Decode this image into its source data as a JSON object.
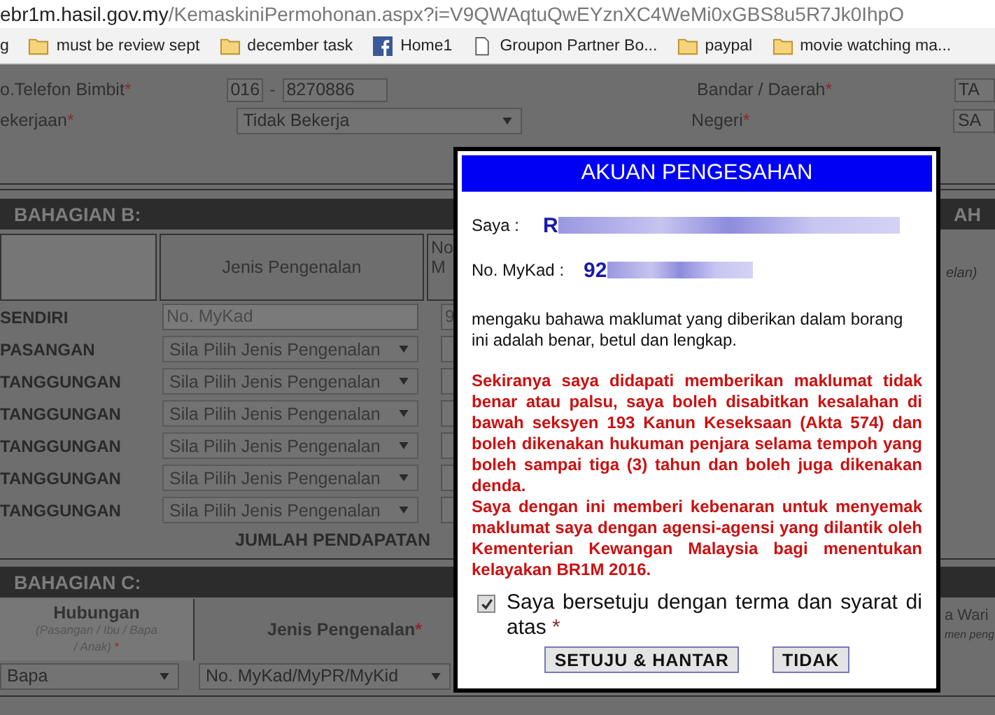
{
  "browser": {
    "url_domain": "ebr1m.hasil.gov.my",
    "url_path": "/KemaskiniPermohonan.aspx?i=V9QWAqtuQwEYznXC4WeMi0xGBS8u5R7Jk0IhpO"
  },
  "bookmarks": [
    {
      "kind": "text",
      "label": "g"
    },
    {
      "kind": "folder",
      "label": "must be review sept"
    },
    {
      "kind": "folder",
      "label": "december task"
    },
    {
      "kind": "facebook",
      "label": "Home1"
    },
    {
      "kind": "page",
      "label": "Groupon Partner Bo..."
    },
    {
      "kind": "folder",
      "label": "paypal"
    },
    {
      "kind": "folder",
      "label": "movie  watching ma..."
    }
  ],
  "phone": {
    "label": "o.Telefon Bimbit",
    "mark": "*",
    "prefix": "016",
    "separator": "-",
    "number": "8270886",
    "right_label": "Bandar / Daerah",
    "right_mark": "*",
    "right_value": "TA"
  },
  "occupation": {
    "label": "ekerjaan",
    "mark": "*",
    "value": "Tidak Bekerja",
    "right_label": "Negeri",
    "right_mark": "*",
    "right_value": "SA"
  },
  "section_b": {
    "title": "BAHAGIAN B:",
    "right_title": "AH",
    "column_2": "Jenis Pengenalan",
    "column_3": [
      "No",
      "M"
    ],
    "right_hint": "elan)",
    "rows": [
      {
        "label": "SENDIRI",
        "kind": "input",
        "value": "No. MyKad",
        "column_3": "9"
      },
      {
        "label": "PASANGAN",
        "kind": "select",
        "value": "Sila Pilih Jenis Pengenalan"
      },
      {
        "label": "TANGGUNGAN",
        "kind": "select",
        "value": "Sila Pilih Jenis Pengenalan"
      },
      {
        "label": "TANGGUNGAN",
        "kind": "select",
        "value": "Sila Pilih Jenis Pengenalan"
      },
      {
        "label": "TANGGUNGAN",
        "kind": "select",
        "value": "Sila Pilih Jenis Pengenalan"
      },
      {
        "label": "TANGGUNGAN",
        "kind": "select",
        "value": "Sila Pilih Jenis Pengenalan"
      },
      {
        "label": "TANGGUNGAN",
        "kind": "select",
        "value": "Sila Pilih Jenis Pengenalan"
      }
    ],
    "total_label": "JUMLAH PENDAPATAN"
  },
  "section_c": {
    "title": "BAHAGIAN C:",
    "column_1": {
      "label": "Hubungan",
      "hint": "(Pasangan / Ibu / Bapa / Anak)",
      "mark": "*"
    },
    "column_2": {
      "label": "Jenis Pengenalan",
      "mark": "*"
    },
    "right_label": "a Wari",
    "right_hint": "men peng",
    "row": {
      "relation": "Bapa",
      "id_type": "No. MyKad/MyPR/MyKid"
    }
  },
  "dialog": {
    "title": "AKUAN PENGESAHAN",
    "name_label": "Saya :",
    "name_value": "R",
    "id_label": "No. MyKad :",
    "id_value": "92",
    "statement": "mengaku bahawa maklumat yang diberikan dalam borang ini adalah benar, betul dan lengkap.",
    "warnings": [
      "Sekiranya saya didapati memberikan maklumat tidak benar atau palsu, saya boleh disabitkan kesalahan di bawah seksyen 193 Kanun Keseksaan (Akta 574) dan boleh dikenakan hukuman penjara selama tempoh yang boleh sampai tiga (3) tahun dan boleh juga dikenakan denda.",
      "Saya dengan ini memberi kebenaran untuk menyemak maklumat saya dengan agensi-agensi yang dilantik oleh Kementerian Kewangan Malaysia bagi menentukan kelayakan BR1M 2016."
    ],
    "agree": {
      "label": "Saya bersetuju dengan terma dan syarat di atas",
      "mark": "*",
      "checked": true
    },
    "buttons": [
      "SETUJU & HANTAR",
      "TIDAK"
    ]
  }
}
